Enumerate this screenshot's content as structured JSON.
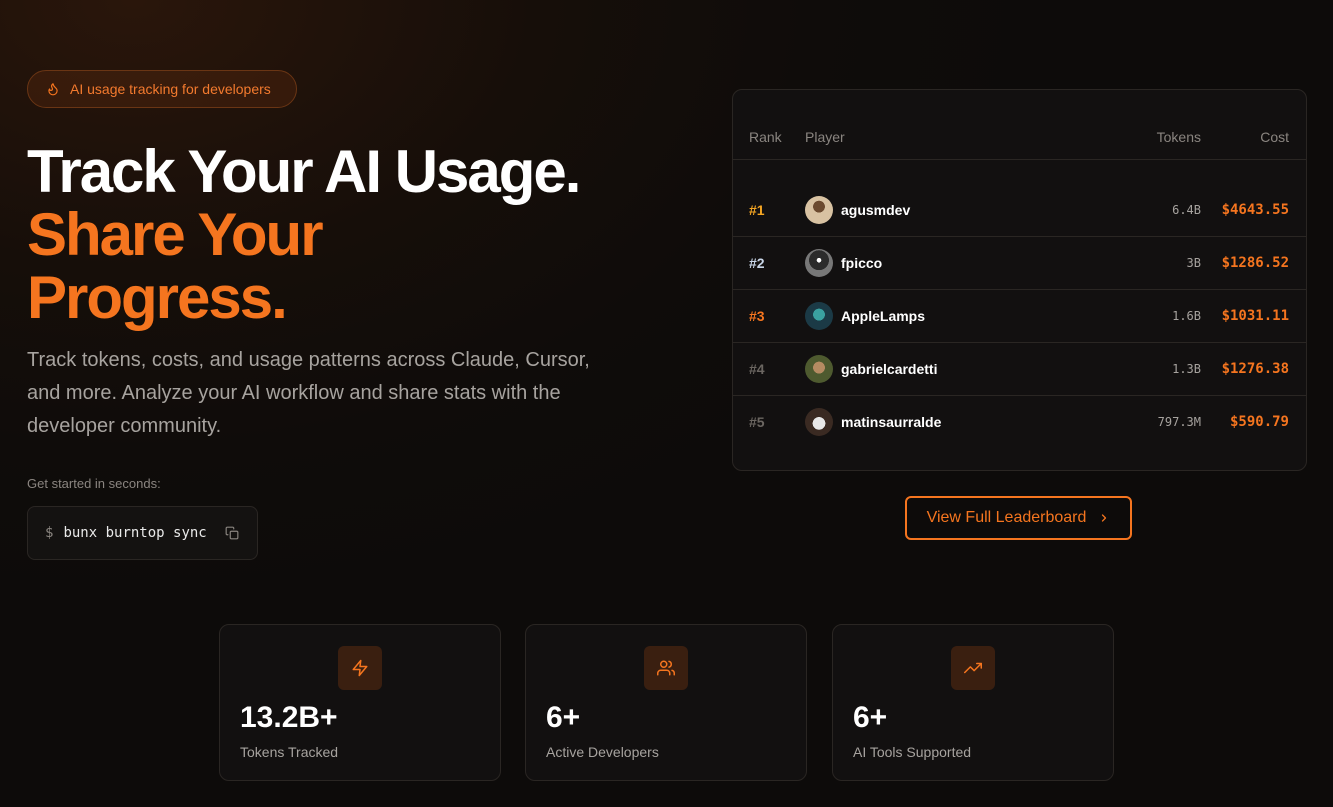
{
  "badge": {
    "text": "AI usage tracking for developers",
    "icon": "flame-icon"
  },
  "hero": {
    "line1": "Track Your AI Usage.",
    "line2": "Share Your",
    "line3": "Progress.",
    "description": "Track tokens, costs, and usage patterns across Claude, Cursor, and more. Analyze your AI workflow and share stats with the developer community."
  },
  "get_started": {
    "label": "Get started in seconds:",
    "prompt": "$",
    "command": "bunx burntop sync",
    "copy_icon": "copy-icon"
  },
  "leaderboard": {
    "headers": {
      "rank": "Rank",
      "player": "Player",
      "tokens": "Tokens",
      "cost": "Cost"
    },
    "rows": [
      {
        "rank": "#1",
        "player": "agusmdev",
        "tokens": "6.4B",
        "cost": "$4643.55",
        "rank_color": "#f5a623"
      },
      {
        "rank": "#2",
        "player": "fpicco",
        "tokens": "3B",
        "cost": "$1286.52",
        "rank_color": "#c9d6e8"
      },
      {
        "rank": "#3",
        "player": "AppleLamps",
        "tokens": "1.6B",
        "cost": "$1031.11",
        "rank_color": "#f5751f"
      },
      {
        "rank": "#4",
        "player": "gabrielcardetti",
        "tokens": "1.3B",
        "cost": "$1276.38",
        "rank_color": "#6b6661"
      },
      {
        "rank": "#5",
        "player": "matinsaurralde",
        "tokens": "797.3M",
        "cost": "$590.79",
        "rank_color": "#6b6661"
      }
    ],
    "view_full": "View Full Leaderboard"
  },
  "stats": [
    {
      "icon": "lightning-icon",
      "value": "13.2B+",
      "label": "Tokens Tracked"
    },
    {
      "icon": "users-icon",
      "value": "6+",
      "label": "Active Developers"
    },
    {
      "icon": "trending-up-icon",
      "value": "6+",
      "label": "AI Tools Supported"
    }
  ],
  "colors": {
    "accent": "#f5751f",
    "background": "#0f0c0a"
  }
}
